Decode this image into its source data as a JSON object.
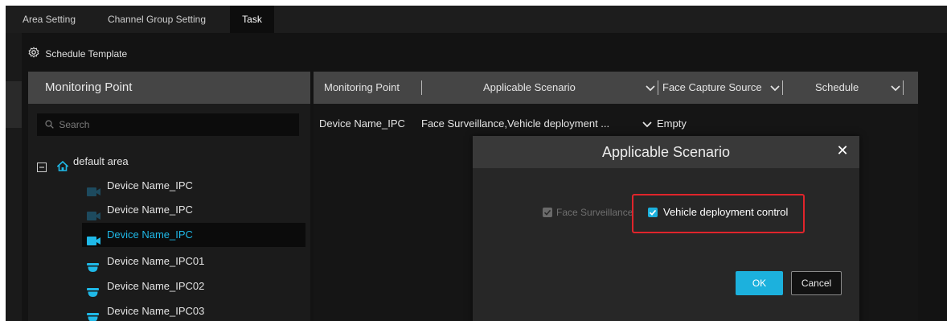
{
  "tabs": [
    {
      "label": "Area Setting"
    },
    {
      "label": "Channel Group Setting"
    },
    {
      "label": "Task"
    }
  ],
  "toolbar": {
    "schedule_template": "Schedule Template"
  },
  "monitoring_panel": {
    "title": "Monitoring Point",
    "search_placeholder": "Search",
    "area": "default area",
    "devices": [
      {
        "name": "Device Name_IPC",
        "icon": "bullet-camera-icon"
      },
      {
        "name": "Device Name_IPC",
        "icon": "bullet-camera-icon"
      },
      {
        "name": "Device Name_IPC",
        "icon": "bullet-camera-icon"
      },
      {
        "name": "Device Name_IPC01",
        "icon": "dome-camera-icon"
      },
      {
        "name": "Device Name_IPC02",
        "icon": "dome-camera-icon"
      },
      {
        "name": "Device Name_IPC03",
        "icon": "dome-camera-icon"
      }
    ]
  },
  "table": {
    "columns": [
      "Monitoring Point",
      "Applicable Scenario",
      "Face Capture Source",
      "Schedule"
    ],
    "rows": [
      {
        "monitoring_point": "Device Name_IPC",
        "scenario": "Face Surveillance,Vehicle deployment ...",
        "face_source": "Empty"
      }
    ]
  },
  "modal": {
    "title": "Applicable Scenario",
    "options": [
      {
        "label": "Face Surveillance",
        "checked": true,
        "disabled": true
      },
      {
        "label": "Vehicle deployment control",
        "checked": true,
        "disabled": false
      }
    ],
    "ok_label": "OK",
    "cancel_label": "Cancel"
  },
  "colors": {
    "accent": "#1cb1dd",
    "highlight": "#e0242b",
    "header_bg": "#454545"
  }
}
